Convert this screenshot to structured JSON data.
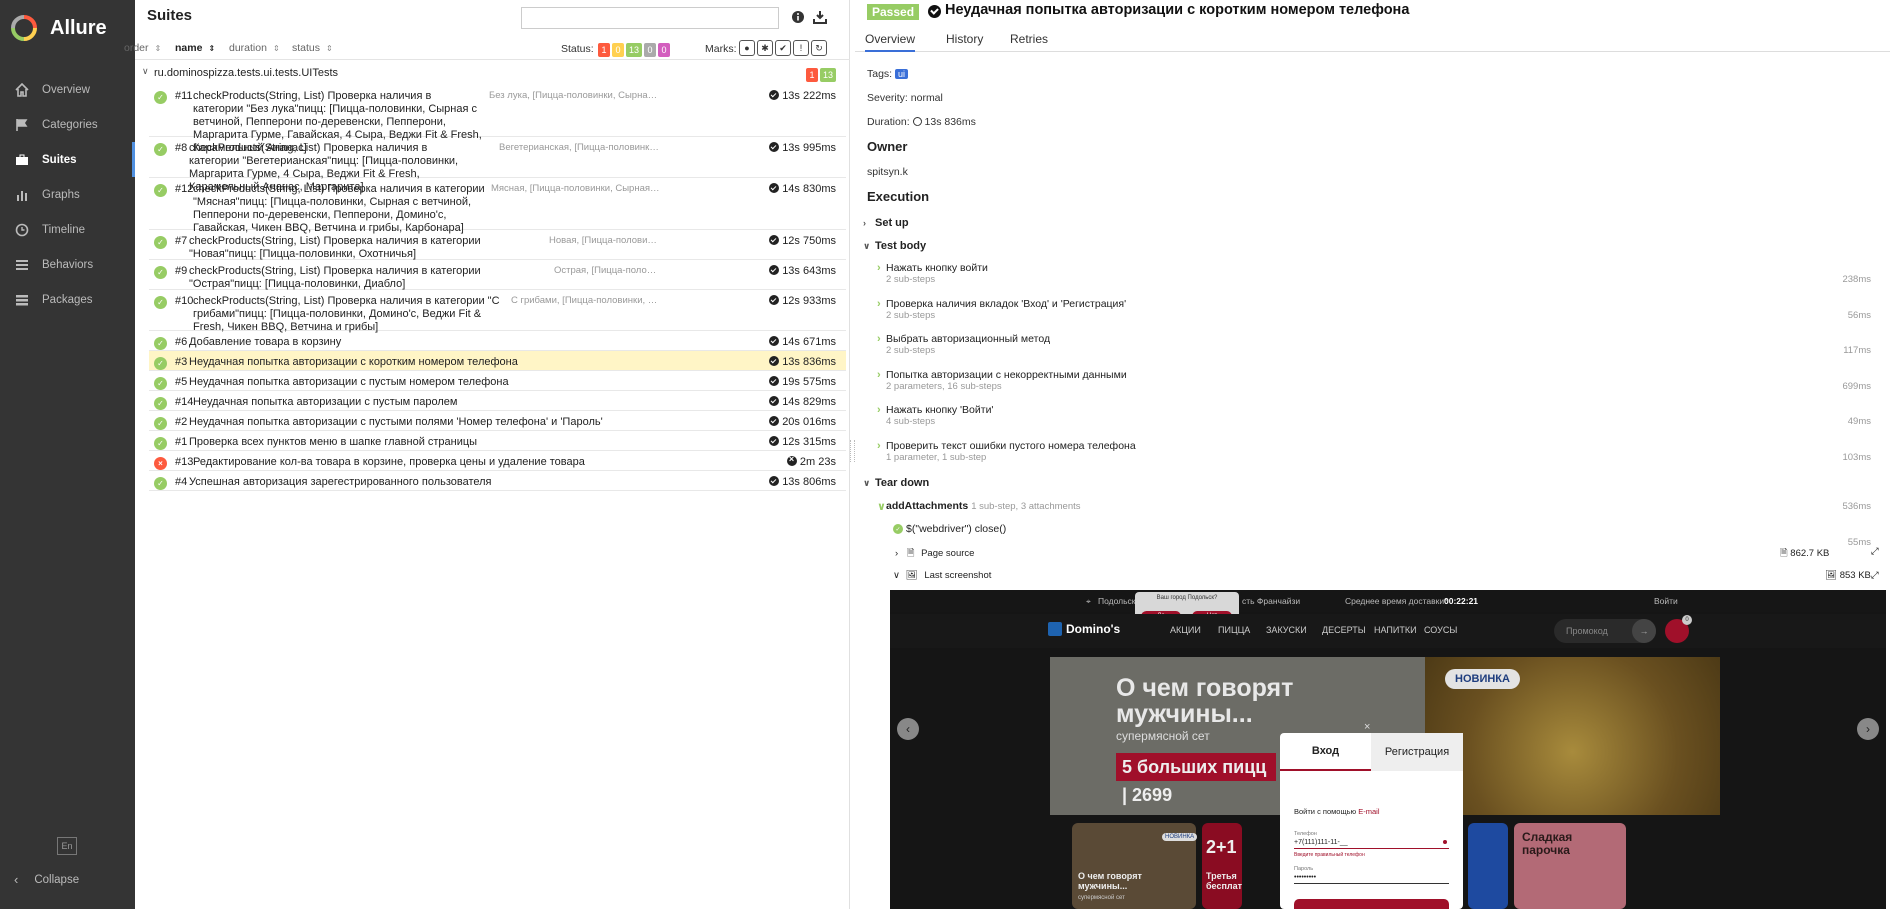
{
  "app": {
    "name": "Allure"
  },
  "sidebar": {
    "items": [
      {
        "label": "Overview",
        "icon": "home-icon"
      },
      {
        "label": "Categories",
        "icon": "flag-icon"
      },
      {
        "label": "Suites",
        "icon": "briefcase-icon",
        "active": true
      },
      {
        "label": "Graphs",
        "icon": "bar-chart-icon"
      },
      {
        "label": "Timeline",
        "icon": "clock-icon"
      },
      {
        "label": "Behaviors",
        "icon": "list-icon"
      },
      {
        "label": "Packages",
        "icon": "layers-icon"
      }
    ],
    "lang": "En",
    "collapse": "Collapse"
  },
  "suites": {
    "title": "Suites",
    "search_value": "",
    "sort": {
      "order": "order",
      "name": "name",
      "duration": "duration",
      "status": "status"
    },
    "status_label": "Status:",
    "status_counts": {
      "failed": "1",
      "broken": "0",
      "passed": "13",
      "skipped": "0",
      "unknown": "0"
    },
    "marks_label": "Marks:",
    "group": {
      "name": "ru.dominospizza.tests.ui.tests.UITests",
      "failed": "1",
      "passed": "13"
    },
    "tests": [
      {
        "num": "#11",
        "name": "checkProducts(String, List) Проверка наличия в категории \"Без лука\"пицц: [Пицца-половинки, Сырная с ветчиной, Пепперони по-деревенски, Пепперони, Маргарита Гурме, Гавайская, 4 Сыра, Веджи Fit & Fresh, Карамельный Ананас]",
        "params": "Без лука, [Пицца-половинки, Сырная с ветчиной...",
        "duration": "13s 222ms",
        "status": "passed"
      },
      {
        "num": "#8",
        "name": "checkProducts(String, List) Проверка наличия в категории \"Вегетерианская\"пицц: [Пицца-половинки, Маргарита Гурме, 4 Сыра, Веджи Fit & Fresh, Карамельный Ананас, Маргарита]",
        "params": "Вегетерианская, [Пицца-половинки, Маргари...",
        "duration": "13s 995ms",
        "status": "passed"
      },
      {
        "num": "#12",
        "name": "checkProducts(String, List) Проверка наличия в категории \"Мясная\"пицц: [Пицца-половинки, Сырная с ветчиной, Пепперони по-деревенски, Пепперони, Домино'с, Гавайская, Чикен BBQ, Ветчина и грибы, Карбонара]",
        "params": "Мясная, [Пицца-половинки, Сырная с ветчиной...",
        "duration": "14s 830ms",
        "status": "passed"
      },
      {
        "num": "#7",
        "name": "checkProducts(String, List) Проверка наличия в категории \"Новая\"пицц: [Пицца-половинки, Охотничья]",
        "params": "Новая, [Пицца-половинки, Ох...",
        "duration": "12s 750ms",
        "status": "passed"
      },
      {
        "num": "#9",
        "name": "checkProducts(String, List) Проверка наличия в категории \"Острая\"пицц: [Пицца-половинки, Диабло]",
        "params": "Острая, [Пицца-половинки, Д...",
        "duration": "13s 643ms",
        "status": "passed"
      },
      {
        "num": "#10",
        "name": "checkProducts(String, List) Проверка наличия в категории \"С грибами\"пицц: [Пицца-половинки, Домино'с, Веджи Fit & Fresh, Чикен BBQ, Ветчина и грибы]",
        "params": "С грибами, [Пицца-половинки, Домино'с, ...",
        "duration": "12s 933ms",
        "status": "passed"
      },
      {
        "num": "#6",
        "name": "Добавление товара в корзину",
        "params": "",
        "duration": "14s 671ms",
        "status": "passed"
      },
      {
        "num": "#3",
        "name": "Неудачная попытка авторизации с коротким номером телефона",
        "params": "",
        "duration": "13s 836ms",
        "status": "passed",
        "selected": true
      },
      {
        "num": "#5",
        "name": "Неудачная попытка авторизации с пустым номером телефона",
        "params": "",
        "duration": "19s 575ms",
        "status": "passed"
      },
      {
        "num": "#14",
        "name": "Неудачная попытка авторизации с пустым паролем",
        "params": "",
        "duration": "14s 829ms",
        "status": "passed"
      },
      {
        "num": "#2",
        "name": "Неудачная попытка авторизации с пустыми полями 'Номер телефона' и 'Пароль'",
        "params": "",
        "duration": "20s 016ms",
        "status": "passed"
      },
      {
        "num": "#1",
        "name": "Проверка всех пунктов меню в шапке главной страницы",
        "params": "",
        "duration": "12s 315ms",
        "status": "passed"
      },
      {
        "num": "#13",
        "name": "Редактирование кол-ва товара в корзине, проверка цены и удаление товара",
        "params": "",
        "duration": "2m 23s",
        "status": "failed"
      },
      {
        "num": "#4",
        "name": "Успешная авторизация зарегестрированного пользователя",
        "params": "",
        "duration": "13s 806ms",
        "status": "passed"
      }
    ]
  },
  "detail": {
    "status": "Passed",
    "title": "Неудачная попытка авторизации с коротким номером телефона",
    "tabs": [
      "Overview",
      "History",
      "Retries"
    ],
    "tags_label": "Tags:",
    "tag": "ui",
    "severity": "Severity: normal",
    "duration_label": "Duration:",
    "duration": "13s 836ms",
    "owner_heading": "Owner",
    "owner": "spitsyn.k",
    "execution_heading": "Execution",
    "setup": "Set up",
    "test_body": "Test body",
    "steps": [
      {
        "name": "Нажать кнопку войти",
        "sub": "2 sub-steps",
        "dur": "238ms"
      },
      {
        "name": "Проверка наличия вкладок 'Вход' и 'Регистрация'",
        "sub": "2 sub-steps",
        "dur": "56ms"
      },
      {
        "name": "Выбрать авторизационный метод",
        "sub": "2 sub-steps",
        "dur": "117ms"
      },
      {
        "name": "Попытка авторизации с некорректными данными",
        "sub": "2 parameters, 16 sub-steps",
        "dur": "699ms"
      },
      {
        "name": "Нажать кнопку 'Войти'",
        "sub": "4 sub-steps",
        "dur": "49ms"
      },
      {
        "name": "Проверить текст ошибки пустого номера телефона",
        "sub": "1 parameter, 1 sub-step",
        "dur": "103ms"
      }
    ],
    "teardown": "Tear down",
    "add_attachments": "addAttachments",
    "add_attachments_meta": "1 sub-step, 3 attachments",
    "add_attachments_dur": "536ms",
    "close_step": "$(\"webdriver\") close()",
    "close_dur": "55ms",
    "page_source": "Page source",
    "page_source_size": "862.7 KB",
    "last_screenshot": "Last screenshot",
    "last_screenshot_size": "853 KB"
  },
  "screenshot": {
    "city": "Подольск",
    "city_popup": "Ваш город Подольск?",
    "popup_yes": "Да",
    "popup_no": "Нет",
    "franchise": "сть Франчайзи",
    "delivery_label": "Среднее время доставки*",
    "delivery_time": "00:22:21",
    "login": "Войти",
    "logo": "Domino's",
    "nav": [
      "АКЦИИ",
      "ПИЦЦА",
      "ЗАКУСКИ",
      "ДЕСЕРТЫ",
      "НАПИТКИ",
      "СОУСЫ"
    ],
    "promo_placeholder": "Промокод",
    "cart_count": "0",
    "banner_big": "О чем говорят мужчины...",
    "banner_small": "супермясной сет",
    "banner_price": "5 больших пицц | 2699",
    "novinka": "НОВИНКА",
    "modal_tab_login": "Вход",
    "modal_tab_register": "Регистрация",
    "modal_hint": "Войти с помощью",
    "modal_hint_link": "E-mail",
    "phone_label": "Телефон",
    "phone_value": "+7(111)111-11-__",
    "phone_error": "Введите правильный телефон",
    "password_label": "Пароль",
    "password_value": "•••••••••",
    "card_new": "НОВИНКА",
    "card1_title": "О чем говорят мужчины...",
    "card1_sub": "супермясной сет",
    "card2_title": "2+1",
    "card2_sub": "Третья бесплатно",
    "card3_title": "Сладкая парочка"
  }
}
